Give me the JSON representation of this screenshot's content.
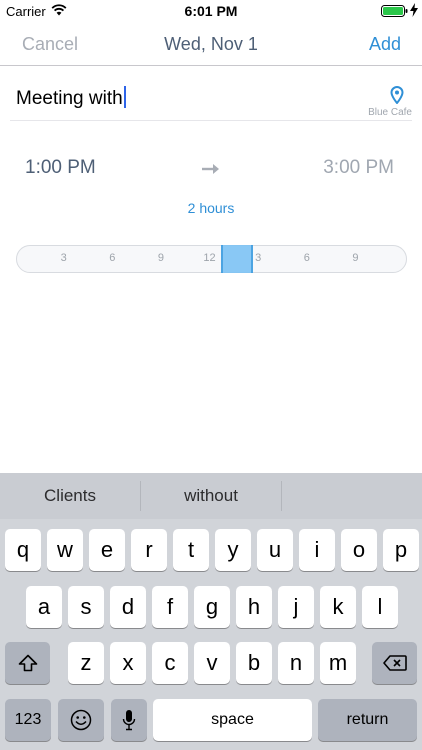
{
  "status_bar": {
    "carrier": "Carrier",
    "time": "6:01 PM"
  },
  "nav": {
    "cancel_label": "Cancel",
    "title": "Wed, Nov 1",
    "add_label": "Add"
  },
  "event": {
    "title_value": "Meeting with",
    "location": "Blue Cafe"
  },
  "time": {
    "start": "1:00 PM",
    "end": "3:00 PM",
    "duration": "2 hours"
  },
  "timeline": {
    "ticks": [
      "3",
      "6",
      "9",
      "12",
      "3",
      "6",
      "9"
    ],
    "selection_start_hour": 13,
    "selection_end_hour": 15
  },
  "keyboard": {
    "suggestions": [
      "Clients",
      "without",
      ""
    ],
    "row1": [
      "q",
      "w",
      "e",
      "r",
      "t",
      "y",
      "u",
      "i",
      "o",
      "p"
    ],
    "row2": [
      "a",
      "s",
      "d",
      "f",
      "g",
      "h",
      "j",
      "k",
      "l"
    ],
    "row3": [
      "z",
      "x",
      "c",
      "v",
      "b",
      "n",
      "m"
    ],
    "numbers_label": "123",
    "space_label": "space",
    "return_label": "return"
  },
  "colors": {
    "accent": "#2f8fd6",
    "title_text": "#4e5f76",
    "selection": "#7ec3f5"
  }
}
